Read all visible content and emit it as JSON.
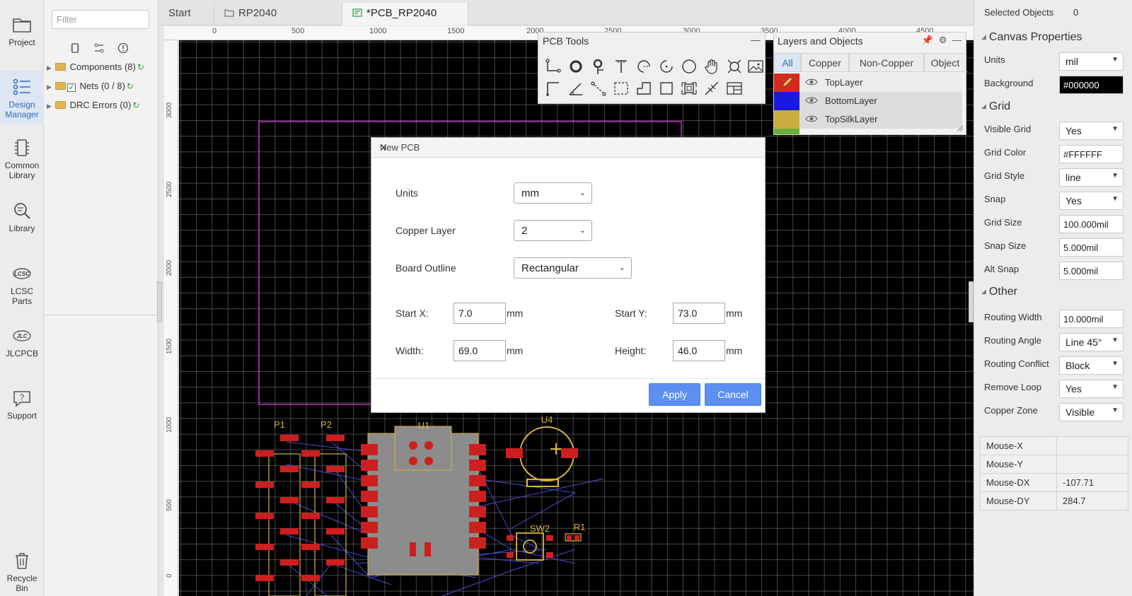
{
  "rail": {
    "project": "Project",
    "design_manager": [
      "Design",
      "Manager"
    ],
    "common_library": [
      "Common",
      "Library"
    ],
    "library": "Library",
    "lcsc": [
      "LCSC",
      "Parts"
    ],
    "jlcpcb": "JLCPCB",
    "support": "Support",
    "recycle": [
      "Recycle",
      "Bin"
    ]
  },
  "left_panel": {
    "filter_placeholder": "Filter",
    "tree": [
      {
        "label": "Components (8)",
        "checked": false
      },
      {
        "label": "Nets (0 / 8)",
        "checked": true
      },
      {
        "label": "DRC Errors (0)",
        "checked": false
      }
    ]
  },
  "tabs": [
    {
      "label": "Start"
    },
    {
      "label": "RP2040"
    },
    {
      "label": "*PCB_RP2040"
    }
  ],
  "ruler": {
    "top": [
      "0",
      "500",
      "1000",
      "1500",
      "2000",
      "2500",
      "3000",
      "3500",
      "4000",
      "4500"
    ],
    "left": [
      "3000",
      "2500",
      "2000",
      "1500",
      "1000",
      "500",
      "0"
    ]
  },
  "pcb": {
    "components": [
      "P1",
      "P2",
      "U1",
      "U4",
      "SW2",
      "R1"
    ],
    "outline_color": "#c030c0",
    "pad_color": "#cc1f1f",
    "silk_color": "#d6b440",
    "ratline_color": "#4b4bd6"
  },
  "pcb_tools": {
    "title": "PCB Tools",
    "tools": [
      "track-icon",
      "pad-icon",
      "via-icon",
      "text-icon",
      "arc-icon",
      "arc2-icon",
      "circle-icon",
      "hand-icon",
      "hole-icon",
      "image-icon",
      "corner-icon",
      "angle-icon",
      "connect-icon",
      "select-icon",
      "solid-region-icon",
      "rect-icon",
      "copper-area-icon",
      "dimension-icon"
    ]
  },
  "layers": {
    "title": "Layers and Objects",
    "tabs": [
      "All",
      "Copper",
      "Non-Copper",
      "Object"
    ],
    "rows": [
      {
        "name": "TopLayer",
        "color": "#d52b1e"
      },
      {
        "name": "BottomLayer",
        "color": "#1a1adb"
      },
      {
        "name": "TopSilkLayer",
        "color": "#c9ad3d"
      }
    ]
  },
  "props": {
    "selected_label": "Selected Objects",
    "selected_value": "0",
    "canvas_section": "Canvas Properties",
    "units_label": "Units",
    "units_value": "mil",
    "background_label": "Background",
    "background_value": "#000000",
    "grid_section": "Grid",
    "visible_grid_label": "Visible Grid",
    "visible_grid_value": "Yes",
    "grid_color_label": "Grid Color",
    "grid_color_value": "#FFFFFF",
    "grid_style_label": "Grid Style",
    "grid_style_value": "line",
    "snap_label": "Snap",
    "snap_value": "Yes",
    "grid_size_label": "Grid Size",
    "grid_size_value": "100.000mil",
    "snap_size_label": "Snap Size",
    "snap_size_value": "5.000mil",
    "alt_snap_label": "Alt Snap",
    "alt_snap_value": "5.000mil",
    "other_section": "Other",
    "routing_width_label": "Routing Width",
    "routing_width_value": "10.000mil",
    "routing_angle_label": "Routing Angle",
    "routing_angle_value": "Line 45°",
    "routing_conflict_label": "Routing Conflict",
    "routing_conflict_value": "Block",
    "remove_loop_label": "Remove Loop",
    "remove_loop_value": "Yes",
    "copper_zone_label": "Copper Zone",
    "copper_zone_value": "Visible",
    "mouse": [
      {
        "label": "Mouse-X",
        "value": ""
      },
      {
        "label": "Mouse-Y",
        "value": ""
      },
      {
        "label": "Mouse-DX",
        "value": "-107.71"
      },
      {
        "label": "Mouse-DY",
        "value": "284.7"
      }
    ]
  },
  "dialog": {
    "title": "New PCB",
    "units_label": "Units",
    "units_value": "mm",
    "copper_label": "Copper Layer",
    "copper_value": "2",
    "outline_label": "Board Outline",
    "outline_value": "Rectangular",
    "startx_label": "Start X:",
    "startx_value": "7.0",
    "starty_label": "Start Y:",
    "starty_value": "73.0",
    "width_label": "Width:",
    "width_value": "69.0",
    "height_label": "Height:",
    "height_value": "46.0",
    "unit": "mm",
    "apply": "Apply",
    "cancel": "Cancel"
  },
  "colors": {
    "accent": "#2f6fbd",
    "button": "#5b8ff0"
  }
}
